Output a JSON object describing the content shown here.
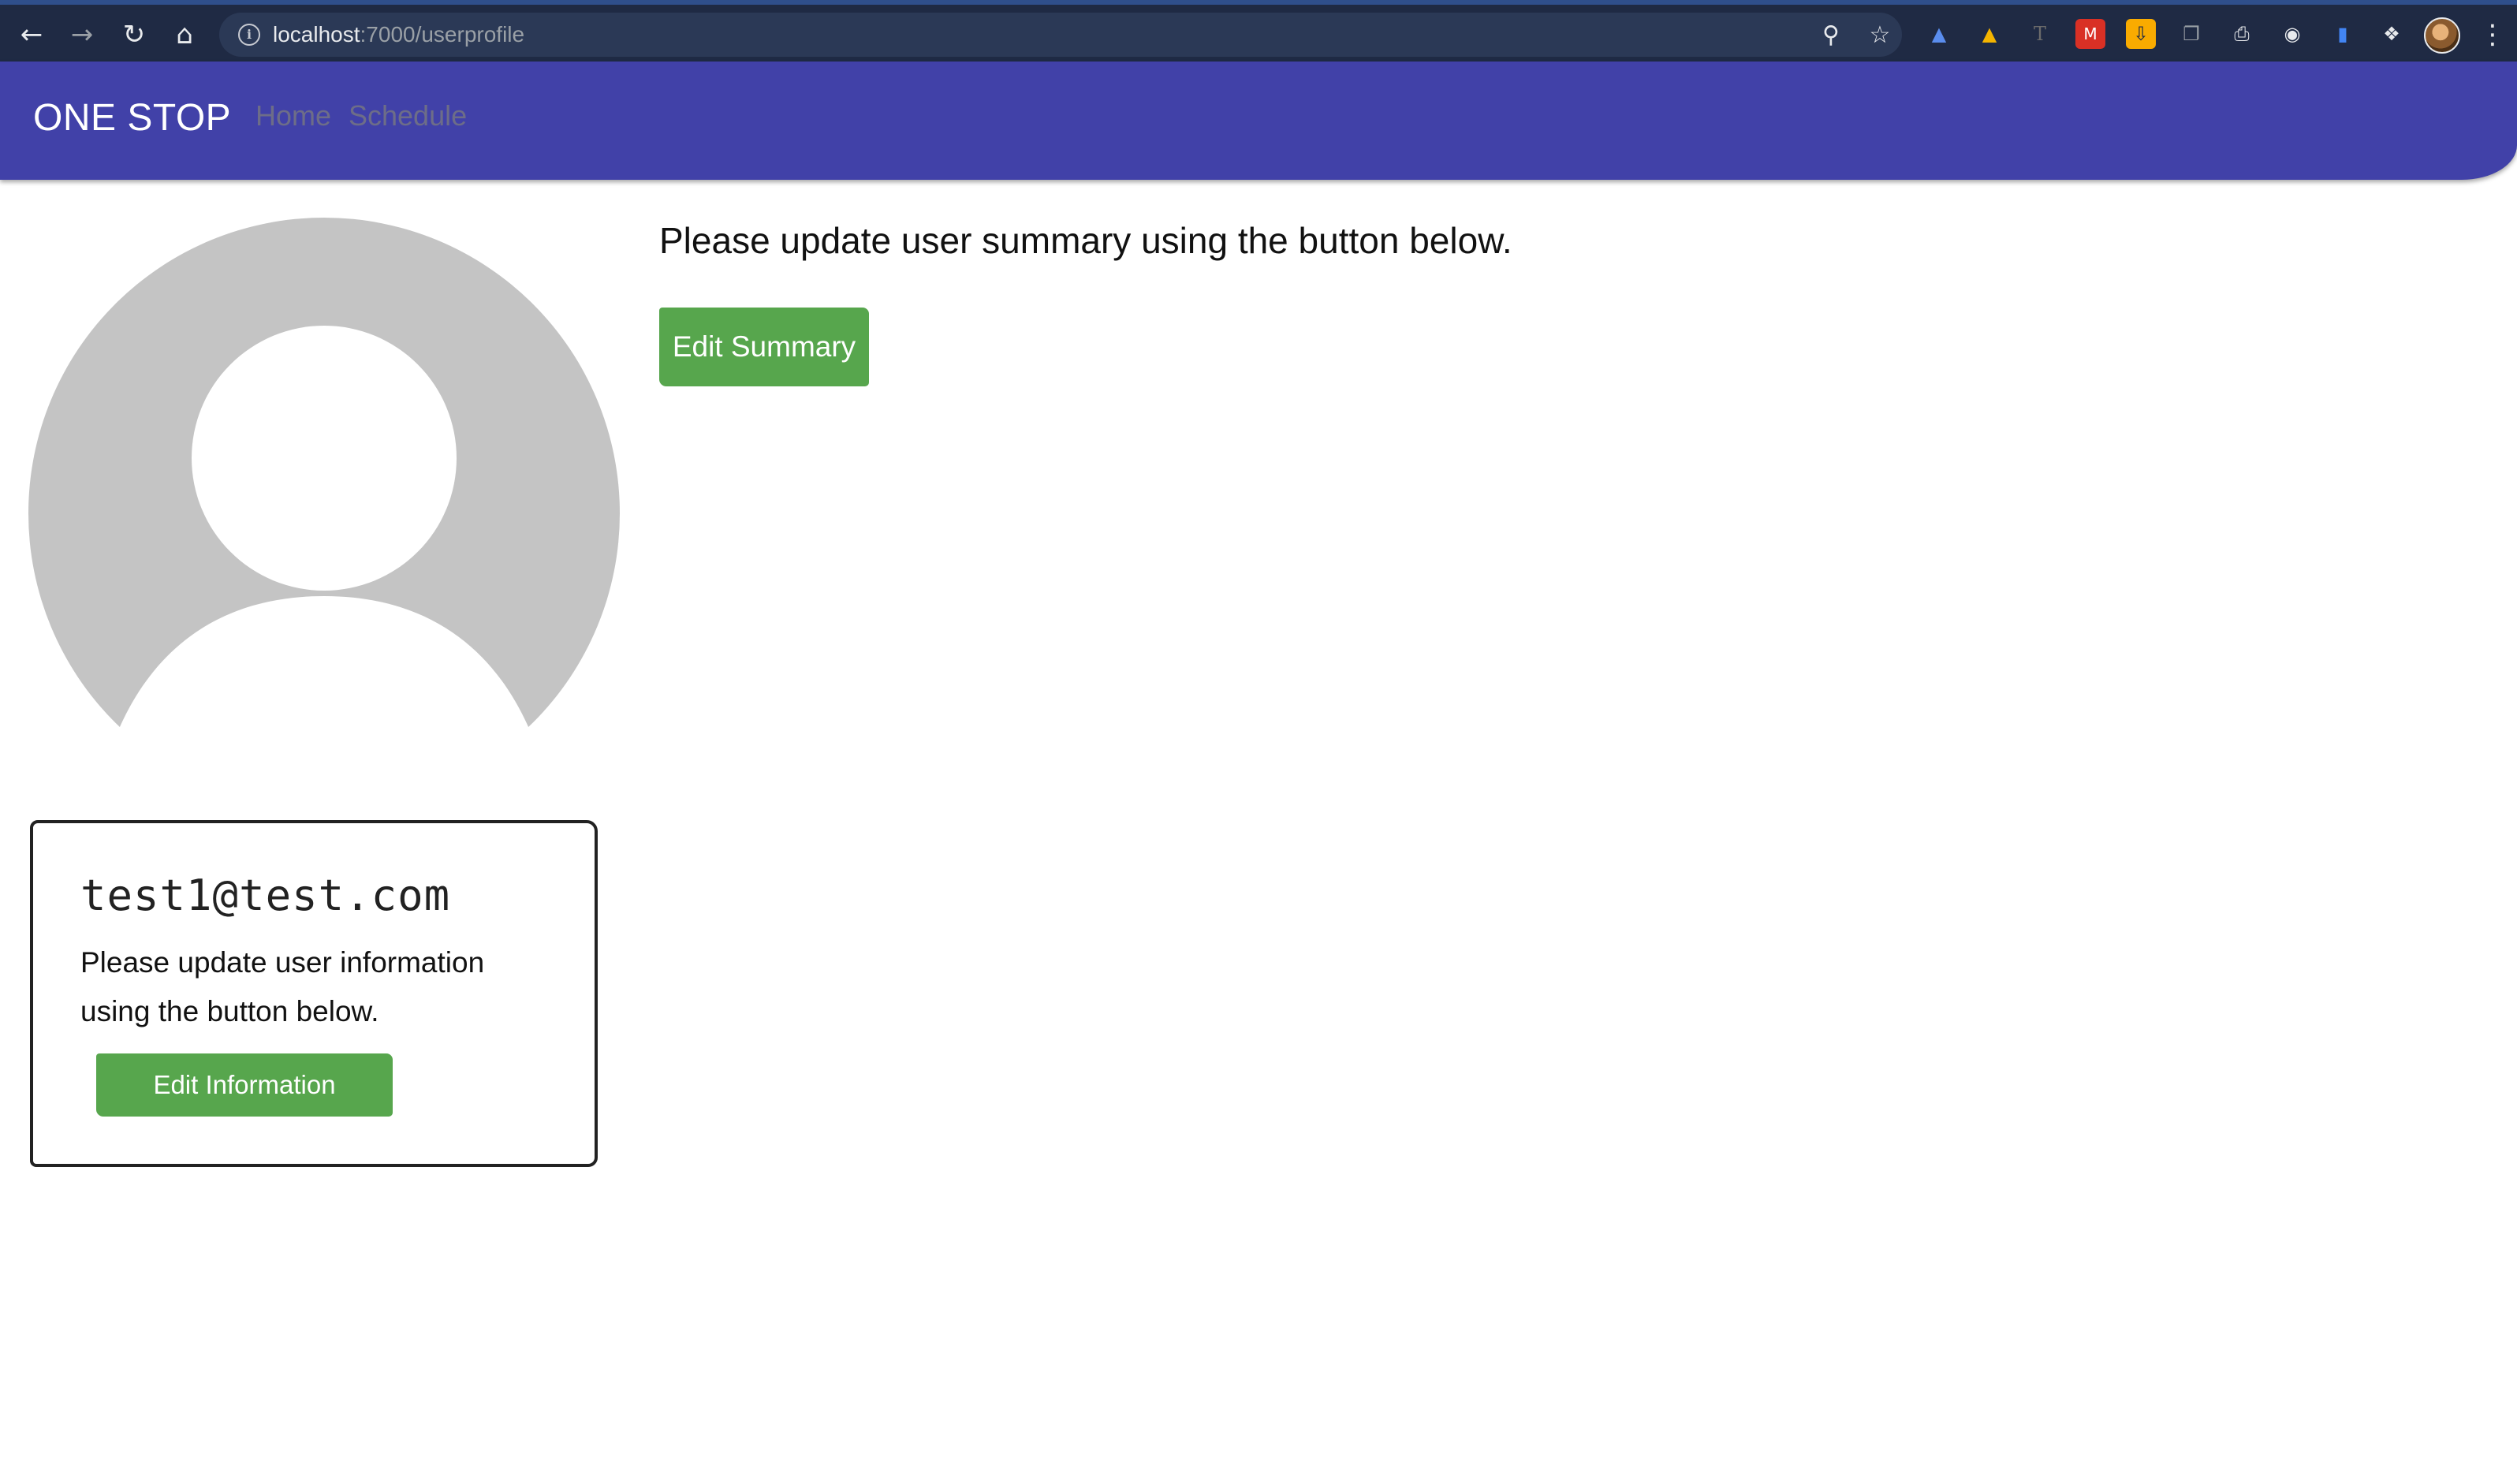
{
  "browser": {
    "url_host": "localhost",
    "url_path": ":7000/userprofile",
    "extensions": [
      {
        "name": "graduation-cap-icon",
        "color": "#5a8dee"
      },
      {
        "name": "google-drive-icon",
        "color": "#f4b400"
      },
      {
        "name": "typography-icon",
        "color": "#6b6b6b"
      },
      {
        "name": "mendeley-icon",
        "color": "#d93025"
      },
      {
        "name": "download-icon",
        "color": "#f9ab00"
      },
      {
        "name": "copy-icon",
        "color": "#9aa0a6"
      },
      {
        "name": "printer-icon",
        "color": "#e8eaed"
      },
      {
        "name": "camera-icon",
        "color": "#e8eaed"
      },
      {
        "name": "tag-icon",
        "color": "#4285f4"
      },
      {
        "name": "puzzle-icon",
        "color": "#e8eaed"
      }
    ]
  },
  "navbar": {
    "brand": "ONE STOP",
    "links": [
      "Home",
      "Schedule"
    ]
  },
  "profile": {
    "email": "test1@test.com",
    "info_prompt": "Please update user information using the button below.",
    "edit_info_label": "Edit Information"
  },
  "summary": {
    "prompt": "Please update user summary using the button below.",
    "edit_summary_label": "Edit Summary"
  },
  "colors": {
    "navbar": "#4141a8",
    "button": "#57a64d",
    "avatar": "#c4c4c4"
  }
}
